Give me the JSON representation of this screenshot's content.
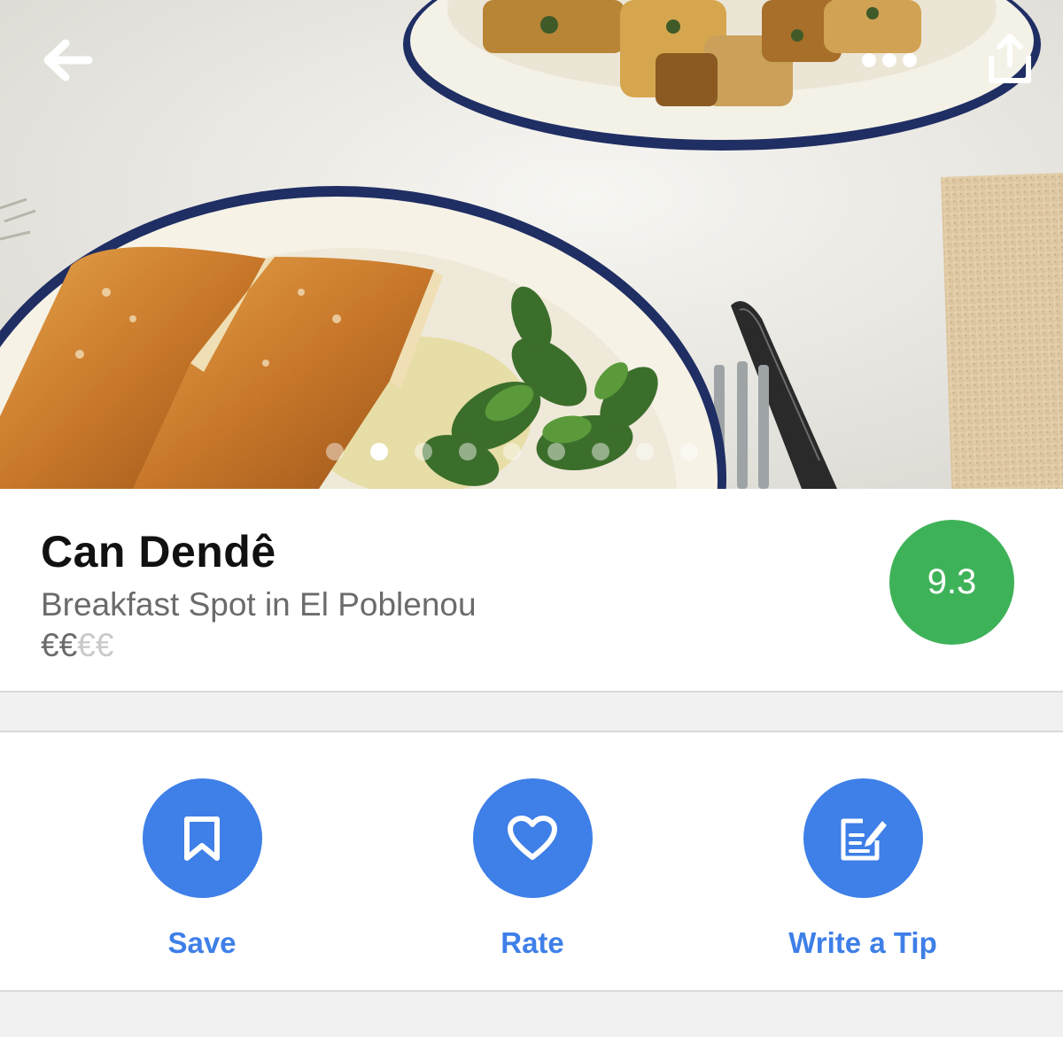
{
  "toolbar": {
    "back_icon": "arrow-left-icon",
    "more_icon": "more-horizontal-icon",
    "share_icon": "share-icon"
  },
  "gallery": {
    "photo_count": 9,
    "active_index": 1
  },
  "venue": {
    "name": "Can Dendê",
    "category_location": "Breakfast Spot in El Poblenou",
    "price_active": "€€",
    "price_inactive": "€€",
    "score": "9.3",
    "score_color": "#3eb258"
  },
  "actions": {
    "save_label": "Save",
    "rate_label": "Rate",
    "tip_label": "Write a Tip",
    "accent_color": "#3e7fe8"
  }
}
